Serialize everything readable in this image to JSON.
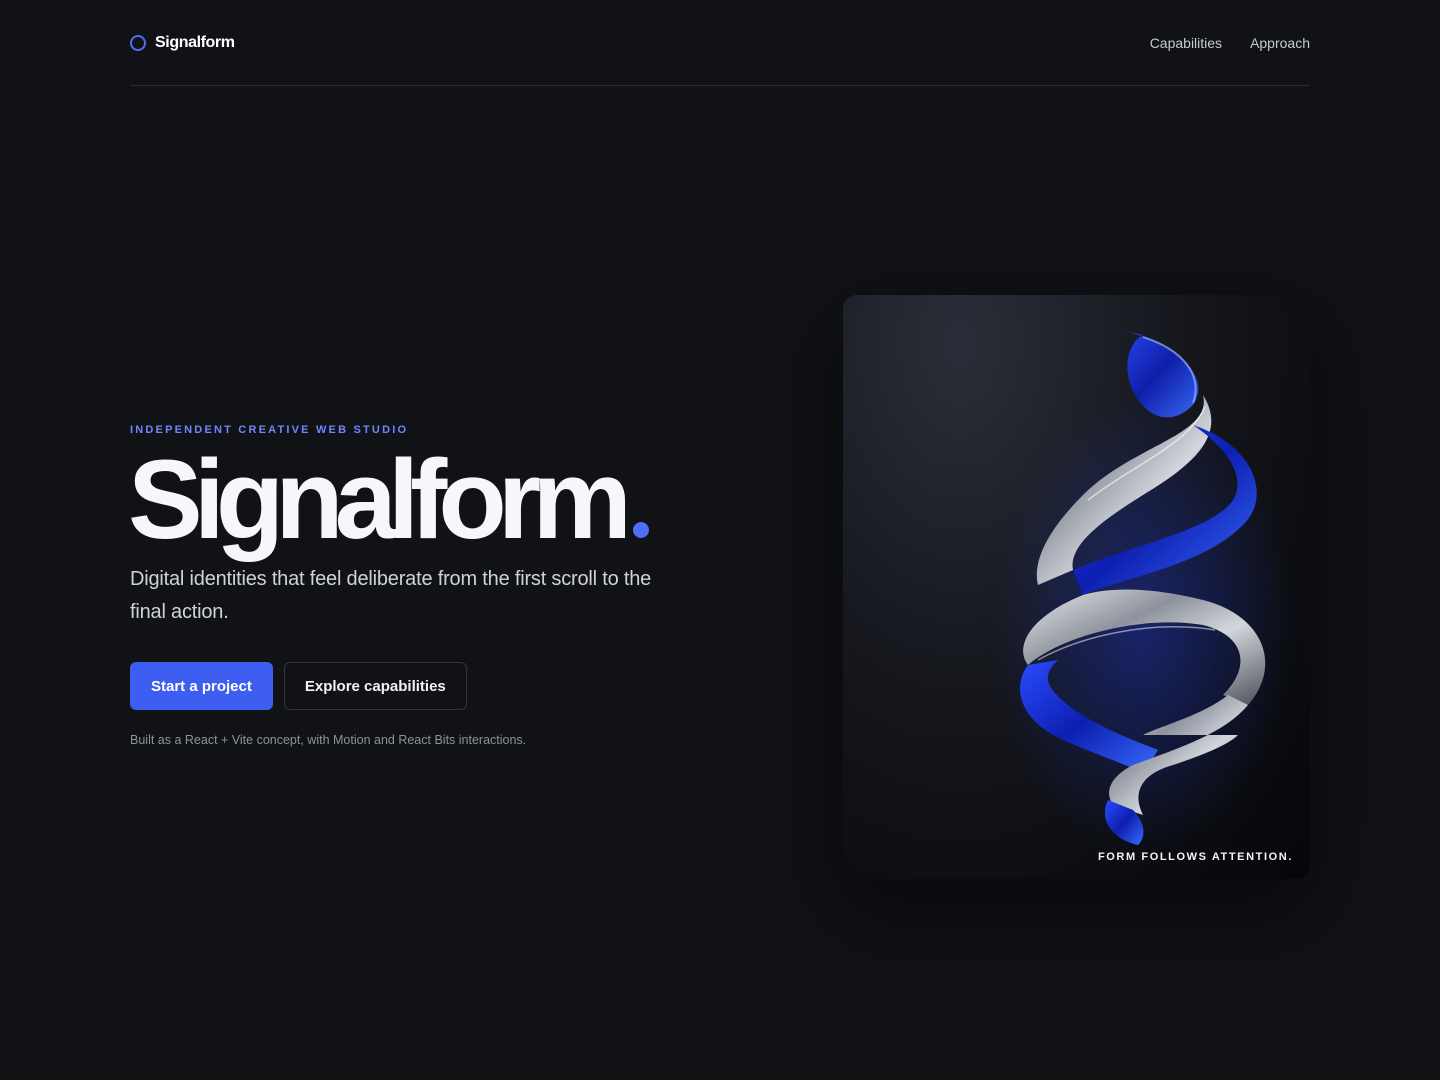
{
  "brand": {
    "name": "Signalform"
  },
  "nav": {
    "items": [
      {
        "label": "Capabilities"
      },
      {
        "label": "Approach"
      }
    ]
  },
  "hero": {
    "eyebrow": "INDEPENDENT CREATIVE WEB STUDIO",
    "title": "Signalform",
    "subtitle": "Digital identities that feel deliberate from the first scroll to the final action.",
    "primary_cta": "Start a project",
    "secondary_cta": "Explore capabilities",
    "footnote": "Built as a React + Vite concept, with Motion and React Bits interactions."
  },
  "card": {
    "caption": "FORM FOLLOWS ATTENTION."
  },
  "colors": {
    "accent": "#4f6df5",
    "background": "#111216",
    "primary_button": "#3d5ef0"
  }
}
